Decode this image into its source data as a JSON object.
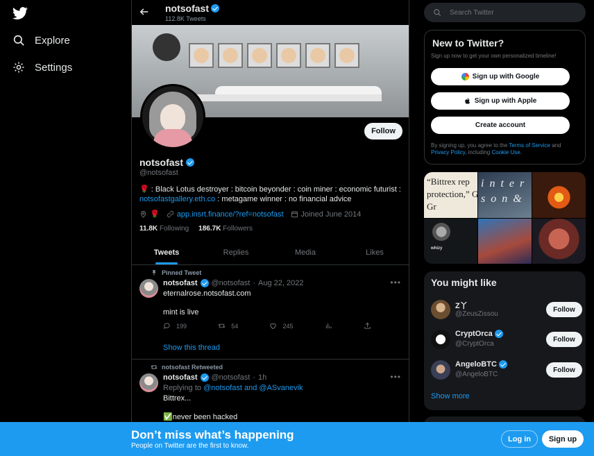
{
  "nav": {
    "logo": "twitter-bird-icon",
    "items": [
      {
        "label": "Explore",
        "icon": "search-icon"
      },
      {
        "label": "Settings",
        "icon": "gear-icon"
      }
    ]
  },
  "header": {
    "name": "notsofast",
    "tweet_count": "112.8K Tweets"
  },
  "profile": {
    "name": "notsofast",
    "handle": "@notsofast",
    "follow_label": "Follow",
    "bio_prefix": "🌹 : Black Lotus destroyer : bitcoin beyonder : coin miner : economic futurist :",
    "bio_link": "notsofastgallery.eth.co",
    "bio_suffix": " : metagame winner : no financial advice",
    "location_emoji": "🌹",
    "website": "app.insrt.finance/?ref=notsofast",
    "joined": "Joined June 2014",
    "following_count": "11.8K",
    "following_label": "Following",
    "followers_count": "186.7K",
    "followers_label": "Followers"
  },
  "tabs": [
    "Tweets",
    "Replies",
    "Media",
    "Likes"
  ],
  "tweets": [
    {
      "context": "Pinned Tweet",
      "name": "notsofast",
      "handle": "@notsofast",
      "time": "Aug 22, 2022",
      "link": "eternalrose.notsofast.com",
      "text": "mint is live",
      "replies": "199",
      "retweets": "54",
      "likes": "245",
      "thread_label": "Show this thread"
    },
    {
      "context": "notsofast Retweeted",
      "name": "notsofast",
      "handle": "@notsofast",
      "time": "1h",
      "replying_prefix": "Replying to",
      "replying_to": "@notsofast and @ASvanevik",
      "text_line1": "Bittrex...",
      "text_line2": "✅never been hacked"
    }
  ],
  "search": {
    "placeholder": "Search Twitter"
  },
  "new_panel": {
    "title": "New to Twitter?",
    "subtitle": "Sign up now to get your own personalized timeline!",
    "google_label": "Sign up with Google",
    "apple_label": "Sign up with Apple",
    "create_label": "Create account",
    "legal_prefix": "By signing up, you agree to the",
    "terms": "Terms of Service",
    "and": "and",
    "privacy": "Privacy Policy",
    "including": ", including",
    "cookie": "Cookie Use."
  },
  "media": {
    "cell1_text": "“Bittrex rep protection,” Gurbir S. Gr",
    "cell2_text": "i n t e r s o n &",
    "cell4_text": "whizy"
  },
  "might_like": {
    "title": "You might like",
    "follow_label": "Follow",
    "show_more": "Show more",
    "accounts": [
      {
        "name": "Z丫",
        "handle": "@ZeusZissou",
        "verified": false
      },
      {
        "name": "CryptOrca",
        "handle": "@CryptOrca",
        "verified": true
      },
      {
        "name": "AngeloBTC",
        "handle": "@AngeloBTC",
        "verified": true
      }
    ]
  },
  "bottom_bar": {
    "title": "Don’t miss what’s happening",
    "subtitle": "People on Twitter are the first to know.",
    "login_label": "Log in",
    "signup_label": "Sign up"
  },
  "colors": {
    "accent": "#1d9bf0",
    "background": "#000000",
    "text": "#e7e9ea",
    "muted": "#71767b"
  }
}
